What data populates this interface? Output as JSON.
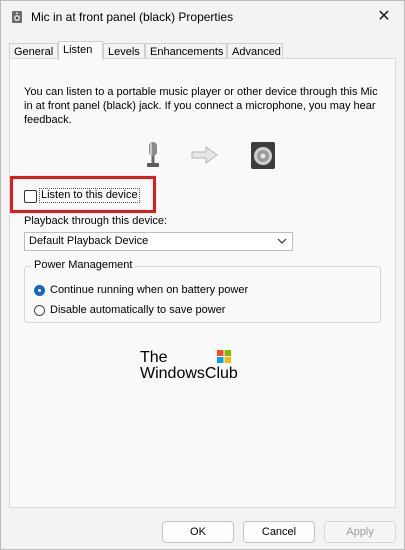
{
  "window": {
    "title": "Mic in at front panel (black) Properties",
    "close_glyph": "✕"
  },
  "tabs": [
    {
      "label": "General"
    },
    {
      "label": "Listen"
    },
    {
      "label": "Levels"
    },
    {
      "label": "Enhancements"
    },
    {
      "label": "Advanced"
    }
  ],
  "active_tab": "Listen",
  "listen": {
    "description": "You can listen to a portable music player or other device through this Mic in at front panel (black) jack.  If you connect a microphone, you may hear feedback.",
    "checkbox_label": "Listen to this device",
    "checkbox_checked": false,
    "playback_label": "Playback through this device:",
    "playback_selected": "Default Playback Device"
  },
  "power": {
    "title": "Power Management",
    "options": [
      {
        "label": "Continue running when on battery power",
        "selected": true
      },
      {
        "label": "Disable automatically to save power",
        "selected": false
      }
    ]
  },
  "watermark": {
    "line1": "The",
    "line2": "WindowsClub"
  },
  "buttons": {
    "ok": "OK",
    "cancel": "Cancel",
    "apply": "Apply"
  },
  "colors": {
    "highlight": "#e01b1b",
    "radio_accent": "#1564c0"
  }
}
